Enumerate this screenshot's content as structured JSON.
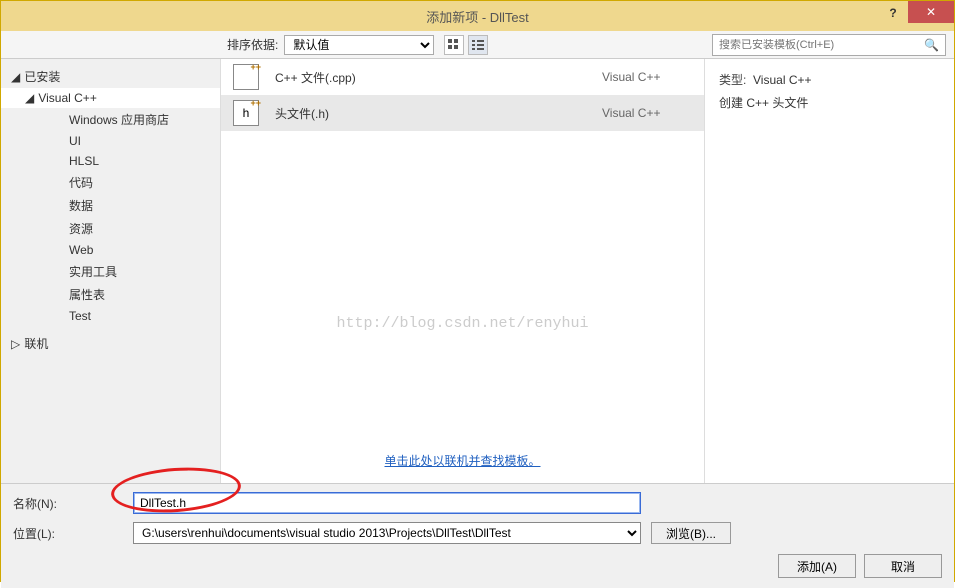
{
  "titlebar": {
    "title": "添加新项 - DllTest",
    "help": "?",
    "close": "✕"
  },
  "topbar": {
    "sort_label": "排序依据:",
    "sort_value": "默认值",
    "search_placeholder": "搜索已安装模板(Ctrl+E)"
  },
  "sidebar": {
    "installed": "已安装",
    "vcpp": "Visual C++",
    "items": [
      "Windows 应用商店",
      "UI",
      "HLSL",
      "代码",
      "数据",
      "资源",
      "Web",
      "实用工具",
      "属性表",
      "Test"
    ],
    "online": "联机"
  },
  "templates": [
    {
      "icon": "[ ]",
      "name": "C++ 文件(.cpp)",
      "type": "Visual C++"
    },
    {
      "icon": "h",
      "name": "头文件(.h)",
      "type": "Visual C++"
    }
  ],
  "watermark": "http://blog.csdn.net/renyhui",
  "online_link": "单击此处以联机并查找模板。",
  "details": {
    "type_label": "类型:",
    "type_value": "Visual C++",
    "desc": "创建 C++ 头文件"
  },
  "form": {
    "name_label": "名称(N):",
    "name_value": "DllTest.h",
    "location_label": "位置(L):",
    "location_value": "G:\\users\\renhui\\documents\\visual studio 2013\\Projects\\DllTest\\DllTest",
    "browse": "浏览(B)...",
    "add": "添加(A)",
    "cancel": "取消"
  }
}
